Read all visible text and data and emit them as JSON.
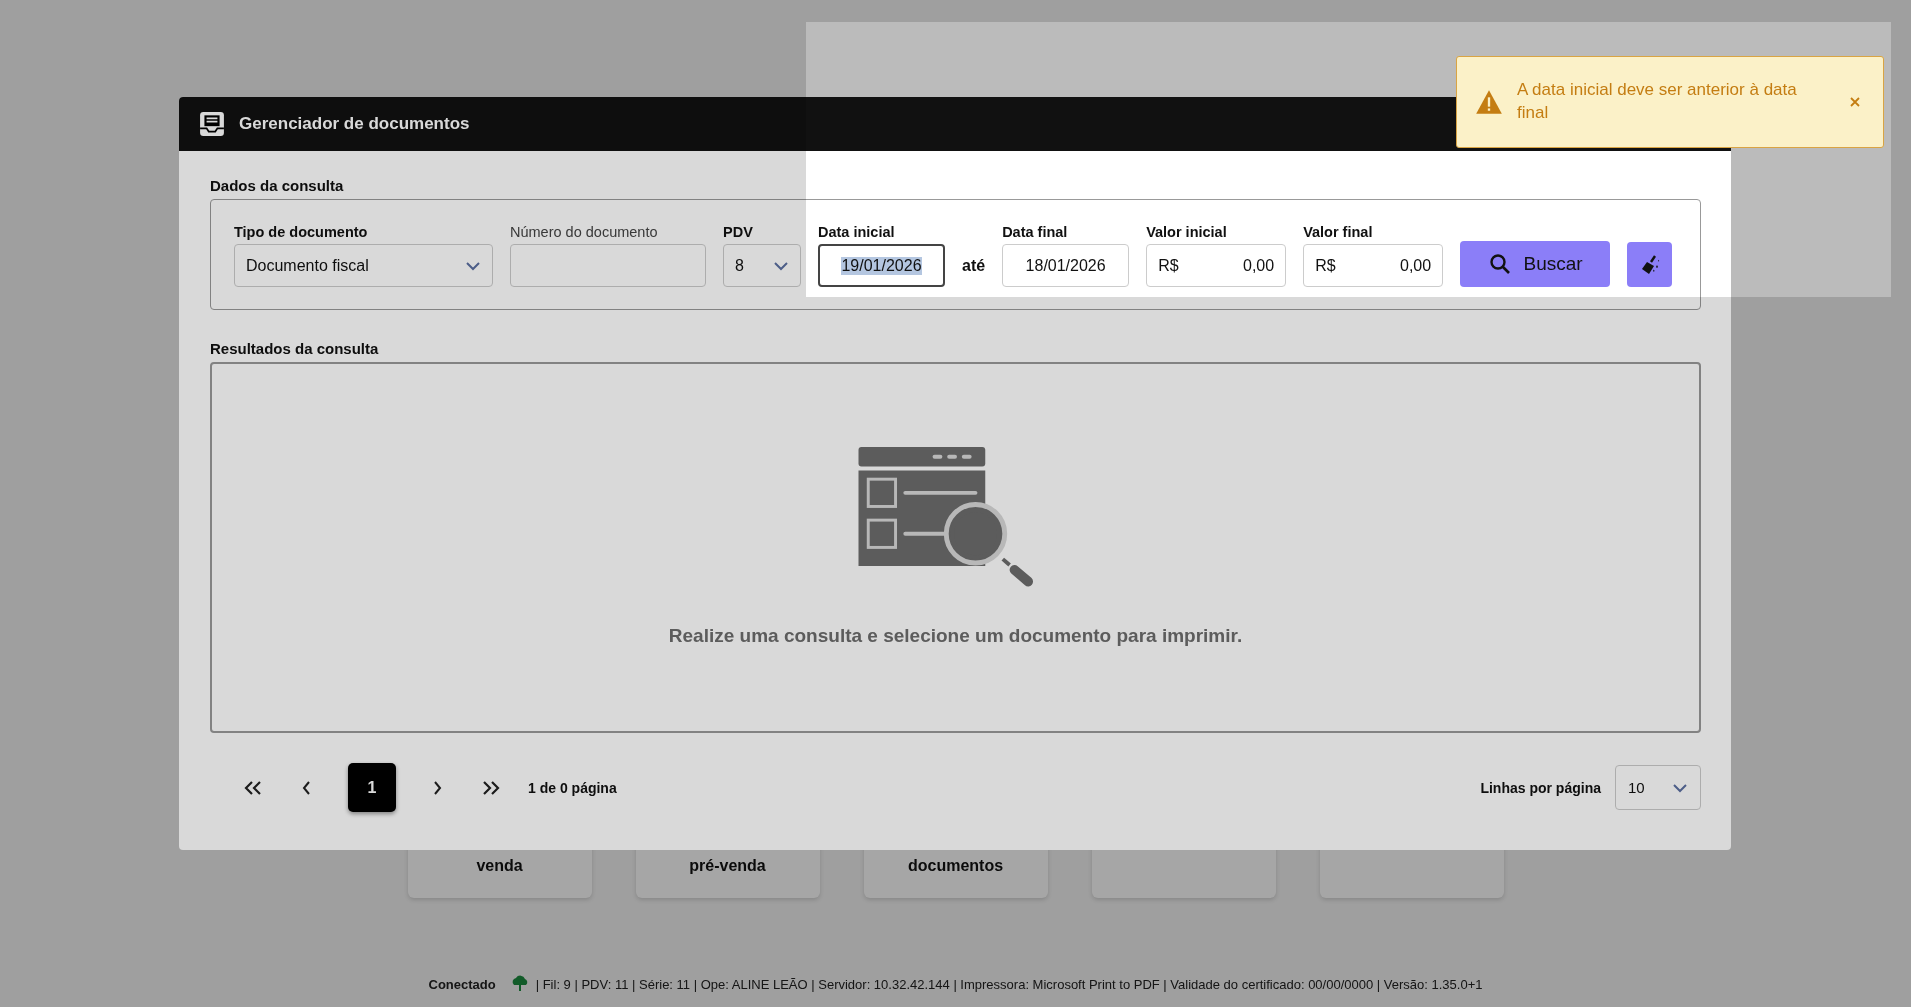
{
  "home": {
    "tiles": [
      {
        "kind": "labelled",
        "lines": [
          "venda"
        ]
      },
      {
        "kind": "labelled",
        "lines": [
          "pré-venda"
        ]
      },
      {
        "kind": "labelled",
        "lines": [
          "documentos"
        ]
      },
      {
        "kind": "blank"
      },
      {
        "kind": "blank"
      }
    ]
  },
  "status_bar": {
    "connection": "Conectado",
    "details": "| Fil: 9 | PDV: 11 | Série: 11 | Ope: ALINE LEÃO | Servidor: 10.32.42.144 | Impressora: Microsoft Print to PDF | Validade do certificado: 00/00/0000 | Versão: 1.35.0+1"
  },
  "dialog": {
    "title": "Gerenciador de documentos",
    "query": {
      "title": "Dados da consulta",
      "fields": [
        {
          "kind": "select",
          "label": "Tipo de documento",
          "emphasized": true,
          "value": "Documento fiscal"
        },
        {
          "kind": "text",
          "label": "Número do documento",
          "emphasized": false
        },
        {
          "kind": "select",
          "label": "PDV",
          "emphasized": true,
          "value": "8"
        },
        {
          "kind": "date",
          "label": "Data inicial",
          "emphasized": true,
          "value": "19/01/2026",
          "focused": true
        },
        {
          "kind": "separator",
          "text": "até"
        },
        {
          "kind": "date",
          "label": "Data final",
          "emphasized": true,
          "value": "18/01/2026",
          "focused": false
        },
        {
          "kind": "money",
          "label": "Valor inicial",
          "emphasized": true,
          "currency": "R$",
          "value": "0,00"
        },
        {
          "kind": "money",
          "label": "Valor final",
          "emphasized": true,
          "currency": "R$",
          "value": "0,00"
        }
      ],
      "search_button": {
        "label": "Buscar"
      }
    },
    "results": {
      "title": "Resultados da consulta",
      "empty_message": "Realize uma consulta e selecione um documento para imprimir."
    },
    "pagination": {
      "pages": [
        {
          "label": "1",
          "selected": true
        }
      ],
      "summary": "1 de 0 página",
      "rows_label": "Linhas por página",
      "rows_value": "10"
    }
  },
  "toast": {
    "message": "A data inicial deve ser anterior à data final"
  }
}
